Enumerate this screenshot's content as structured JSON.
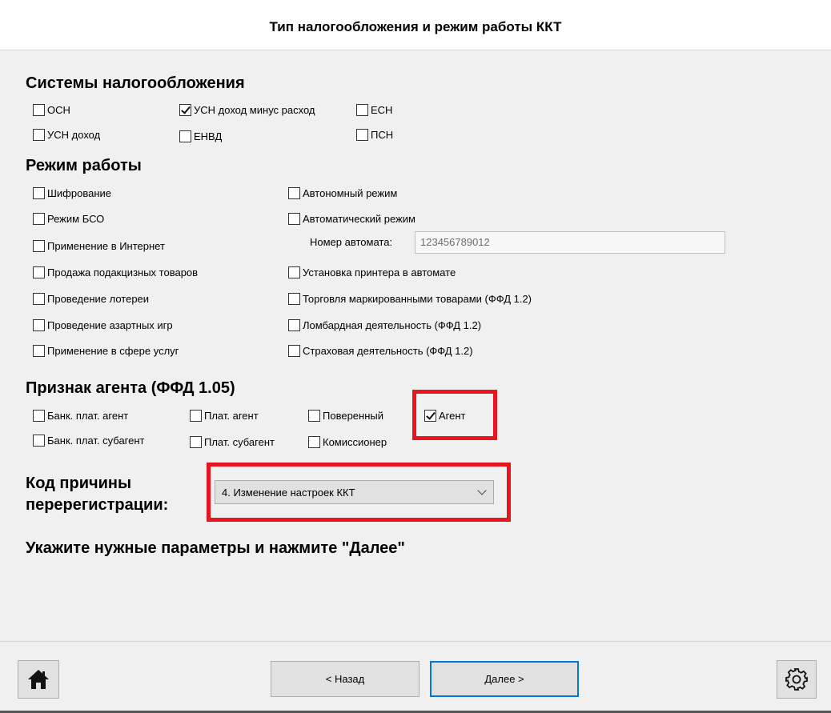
{
  "window": {
    "title": "Тип налогообложения и режим работы ККТ"
  },
  "tax": {
    "title": "Системы налогообложения",
    "items": [
      {
        "label": "ОСН",
        "checked": false
      },
      {
        "label": "УСН доход минус расход",
        "checked": true
      },
      {
        "label": "ЕСН",
        "checked": false
      },
      {
        "label": "УСН доход",
        "checked": false
      },
      {
        "label": "ЕНВД",
        "checked": false
      },
      {
        "label": "ПСН",
        "checked": false
      }
    ]
  },
  "mode": {
    "title": "Режим работы",
    "items": [
      {
        "label": "Шифрование",
        "checked": false
      },
      {
        "label": "Режим БСО",
        "checked": false
      },
      {
        "label": "Применение в Интернет",
        "checked": false
      },
      {
        "label": "Продажа подакцизных товаров",
        "checked": false
      },
      {
        "label": "Проведение лотереи",
        "checked": false
      },
      {
        "label": "Проведение азартных игр",
        "checked": false
      },
      {
        "label": "Применение в сфере услуг",
        "checked": false
      },
      {
        "label": "Автономный режим",
        "checked": false
      },
      {
        "label": "Автоматический режим",
        "checked": false
      },
      {
        "label": "Установка принтера в автомате",
        "checked": false
      },
      {
        "label": "Торговля маркированными товарами (ФФД 1.2)",
        "checked": false
      },
      {
        "label": "Ломбардная деятельность (ФФД 1.2)",
        "checked": false
      },
      {
        "label": "Страховая деятельность (ФФД 1.2)",
        "checked": false
      }
    ],
    "machine_label": "Номер автомата:",
    "machine_number": "123456789012"
  },
  "agent": {
    "title": "Признак агента (ФФД 1.05)",
    "items": [
      {
        "label": "Банк. плат. агент",
        "checked": false
      },
      {
        "label": "Плат. агент",
        "checked": false
      },
      {
        "label": "Поверенный",
        "checked": false
      },
      {
        "label": "Агент",
        "checked": true
      },
      {
        "label": "Банк. плат. субагент",
        "checked": false
      },
      {
        "label": "Плат. субагент",
        "checked": false
      },
      {
        "label": "Комиссионер",
        "checked": false
      }
    ]
  },
  "reason": {
    "label_line1": "Код причины",
    "label_line2": "перерегистрации:",
    "selected": "4. Изменение настроек ККТ"
  },
  "hint": "Укажите нужные параметры и нажмите \"Далее\"",
  "footer": {
    "back_label": "< Назад",
    "next_label": "Далее >",
    "home_icon": "home-icon",
    "settings_icon": "gear-icon"
  },
  "colors": {
    "highlight": "#e8141e",
    "accent": "#0078d7"
  }
}
